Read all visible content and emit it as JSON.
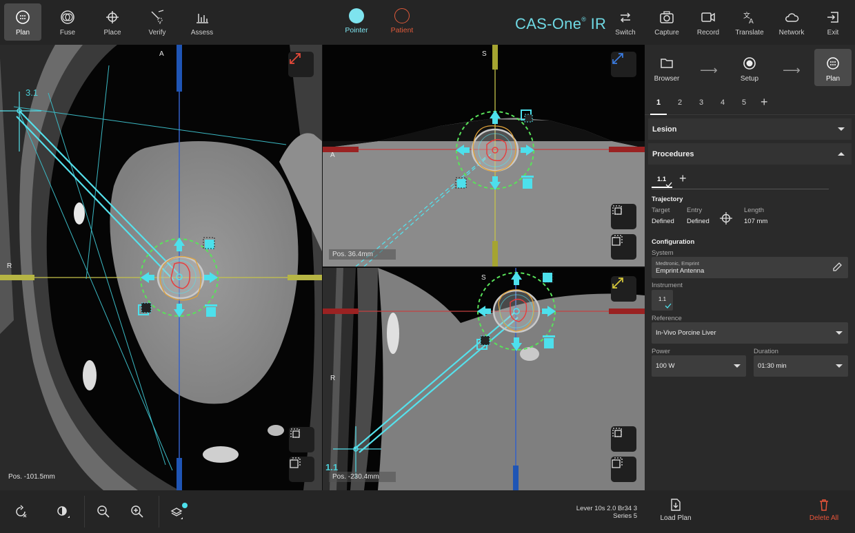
{
  "toolbar": {
    "left": [
      {
        "label": "Plan",
        "icon": "plan-icon",
        "active": true
      },
      {
        "label": "Fuse",
        "icon": "fuse-icon",
        "active": false
      },
      {
        "label": "Place",
        "icon": "place-icon",
        "active": false
      },
      {
        "label": "Verify",
        "icon": "verify-icon",
        "active": false
      },
      {
        "label": "Assess",
        "icon": "assess-icon",
        "active": false
      }
    ],
    "modes": [
      {
        "label": "Pointer",
        "color": "#7ee3ee"
      },
      {
        "label": "Patient",
        "color": "#e05a3a"
      }
    ],
    "brand": {
      "name": "CAS-One",
      "mark": "®",
      "suffix": "IR"
    },
    "right": [
      {
        "label": "Switch",
        "icon": "switch-icon"
      },
      {
        "label": "Capture",
        "icon": "camera-icon"
      },
      {
        "label": "Record",
        "icon": "video-icon"
      },
      {
        "label": "Translate",
        "icon": "translate-icon"
      },
      {
        "label": "Network",
        "icon": "cloud-icon"
      },
      {
        "label": "Exit",
        "icon": "exit-icon"
      }
    ]
  },
  "viewports": {
    "axial": {
      "pos": "Pos. -101.5mm",
      "orient_top": "A",
      "orient_left": "R",
      "traj_label": "3.1"
    },
    "sagittal": {
      "pos": "Pos. 36.4mm",
      "orient_top": "S",
      "orient_left": "A"
    },
    "coronal": {
      "pos": "Pos. -230.4mm",
      "orient_top": "S",
      "orient_left": "R",
      "traj_label": "1.1"
    }
  },
  "bottombar": {
    "series_line1": "Lever 10s  2.0  Br34  3",
    "series_line2": "Series 5"
  },
  "panel": {
    "workflow": [
      {
        "label": "Browser",
        "icon": "folder-icon",
        "active": false
      },
      {
        "label": "Setup",
        "icon": "setup-icon",
        "active": false
      },
      {
        "label": "Plan",
        "icon": "plan-icon",
        "active": true
      }
    ],
    "tabs": [
      "1",
      "2",
      "3",
      "4",
      "5"
    ],
    "lesion_title": "Lesion",
    "procedures_title": "Procedures",
    "procedure_tab": "1.1",
    "trajectory": {
      "title": "Trajectory",
      "target_label": "Target",
      "target_value": "Defined",
      "entry_label": "Entry",
      "entry_value": "Defined",
      "length_label": "Length",
      "length_value": "107 mm"
    },
    "configuration": {
      "title": "Configuration",
      "system_label": "System",
      "system_vendor": "Medtronic, Emprint",
      "system_value": "Emprint Antenna",
      "instrument_label": "Instrument",
      "instrument_value": "1.1",
      "reference_label": "Reference",
      "reference_value": "In-Vivo Porcine Liver",
      "power_label": "Power",
      "power_value": "100 W",
      "duration_label": "Duration",
      "duration_value": "01:30 min"
    },
    "load_plan": "Load Plan",
    "delete_all": "Delete All"
  }
}
